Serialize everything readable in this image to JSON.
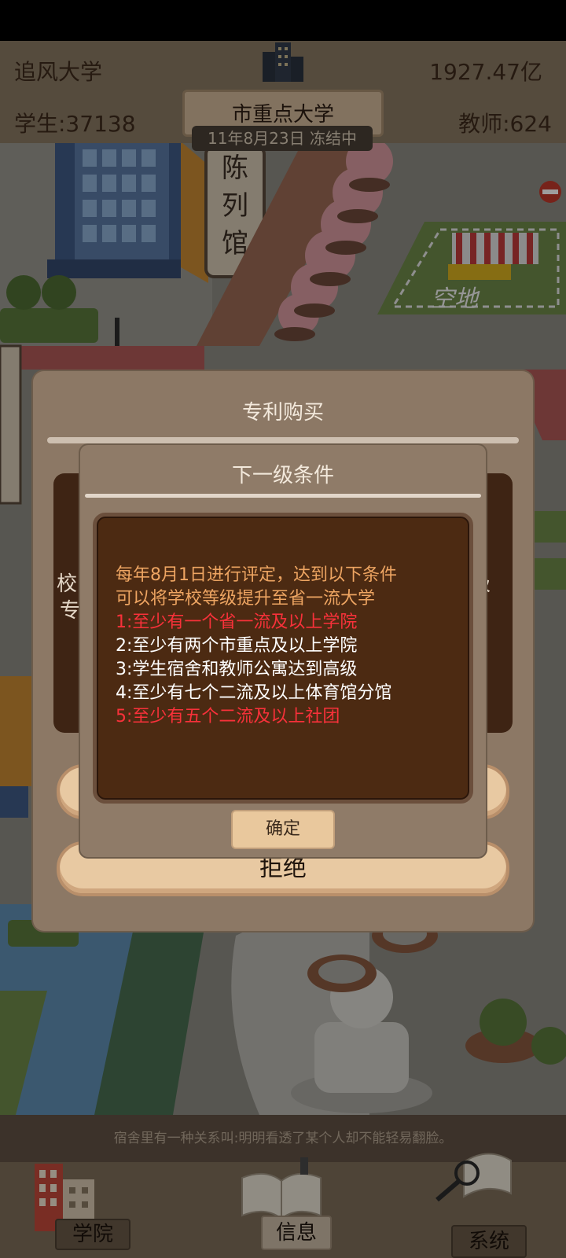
{
  "hud": {
    "school_name": "追风大学",
    "money": "1927.47亿",
    "students": "学生:37138",
    "teachers": "教师:624",
    "rank": "市重点大学",
    "date_status": "11年8月23日 冻结中"
  },
  "map": {
    "exhibit_hall": [
      "陈",
      "列",
      "馆"
    ],
    "empty_lot": "空地"
  },
  "outer_dialog": {
    "title": "专利购买",
    "left_fragment_1": "校",
    "left_fragment_2": "专",
    "right_fragment": "级",
    "accept_label": "",
    "reject_label": "拒绝"
  },
  "inner_dialog": {
    "title": "下一级条件",
    "intro_line_1": "每年8月1日进行评定，达到以下条件",
    "intro_line_2": "可以将学校等级提升至省一流大学",
    "conditions": [
      {
        "text": "1:至少有一个省一流及以上学院",
        "met": false
      },
      {
        "text": "2:至少有两个市重点及以上学院",
        "met": true
      },
      {
        "text": "3:学生宿舍和教师公寓达到高级",
        "met": true
      },
      {
        "text": "4:至少有七个二流及以上体育馆分馆",
        "met": true
      },
      {
        "text": "5:至少有五个二流及以上社团",
        "met": false
      }
    ],
    "ok_label": "确定"
  },
  "tip": "宿舍里有一种关系叫:明明看透了某个人却不能轻易翻脸。",
  "nav": {
    "college": "学院",
    "info": "信息",
    "system": "系统"
  },
  "colors": {
    "intro": "#eea562",
    "met": "#ffffff",
    "unmet": "#f8313a",
    "dialog_bg": "#8c7865",
    "condition_box": "#4c2a12"
  }
}
